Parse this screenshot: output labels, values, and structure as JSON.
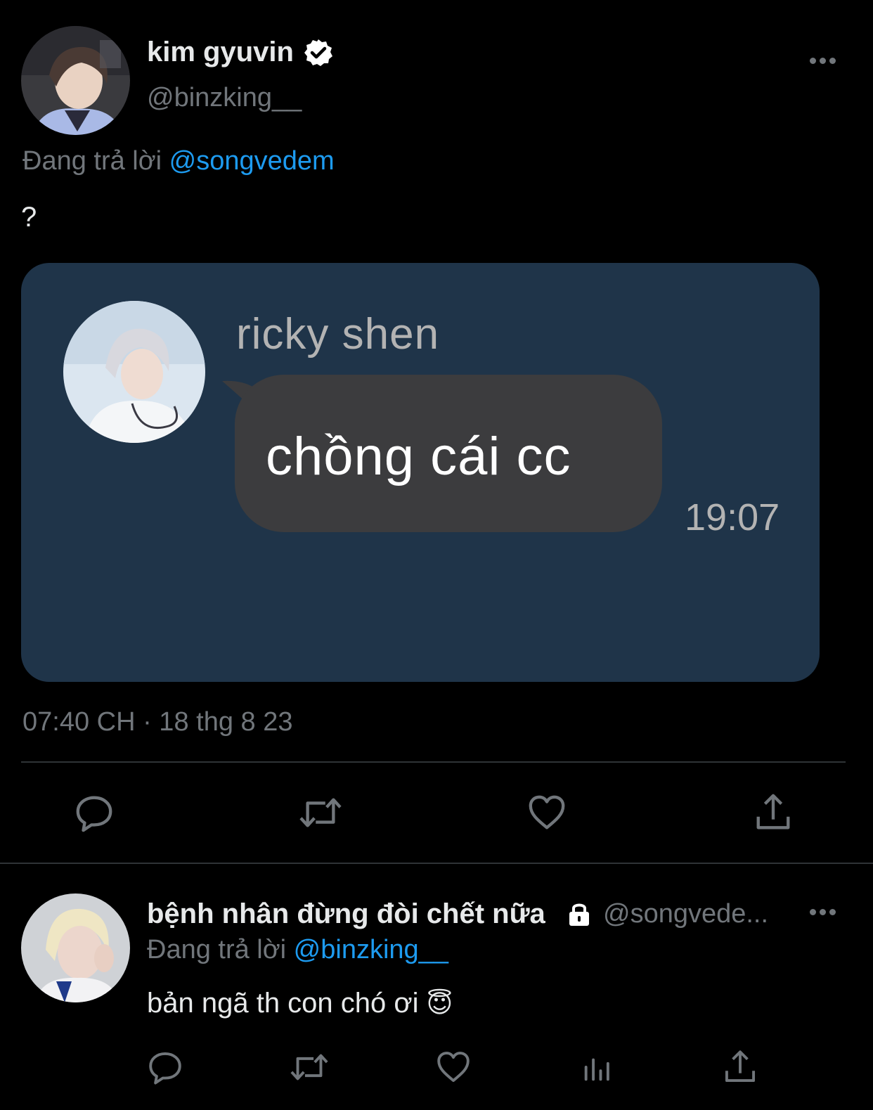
{
  "tweet": {
    "author_name": "kim gyuvin",
    "verified_icon": "verified-badge-icon",
    "author_handle": "@binzking__",
    "reply_prefix": "Đang trả lời",
    "reply_to": "@songvedem",
    "text": "?",
    "media": {
      "chat_name": "ricky shen",
      "chat_message": "chồng cái cc",
      "chat_time": "19:07"
    },
    "timestamp": "07:40 CH · 18 thg 8 23",
    "actions": [
      "reply-icon",
      "retweet-icon",
      "like-icon",
      "share-icon"
    ]
  },
  "reply": {
    "author_name": "bệnh nhân đừng đòi chết nữa",
    "lock_icon": "lock-icon",
    "author_handle": "@songvede...",
    "reply_prefix": "Đang trả lời",
    "reply_to": "@binzking__",
    "text": "bản ngã th con chó ơi",
    "emoji": "😇",
    "actions": [
      "reply-icon",
      "retweet-icon",
      "like-icon",
      "views-icon",
      "share-icon"
    ]
  },
  "colors": {
    "background": "#000000",
    "accent": "#1d9bf0",
    "muted": "#71767b",
    "media_bg": "#1f3449"
  }
}
